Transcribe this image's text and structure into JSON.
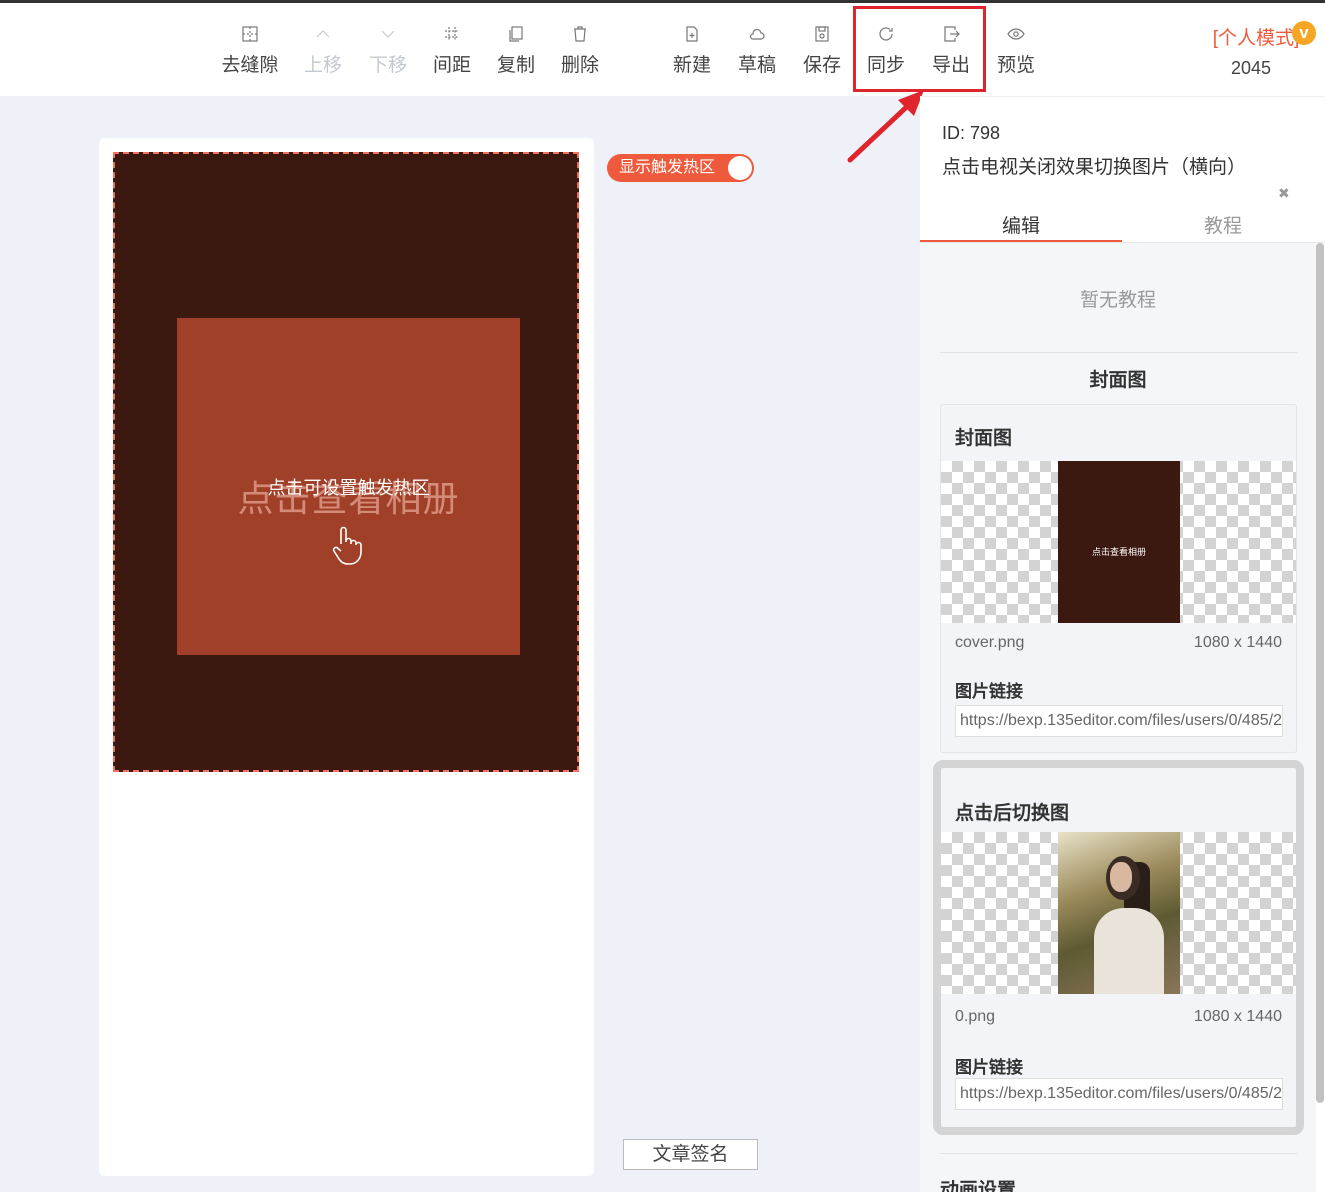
{
  "toolbar": {
    "remove_gap": "去缝隙",
    "move_up": "上移",
    "move_down": "下移",
    "spacing": "间距",
    "copy": "复制",
    "delete": "删除",
    "new": "新建",
    "draft": "草稿",
    "save": "保存",
    "sync": "同步",
    "export": "导出",
    "preview": "预览"
  },
  "mode": {
    "label": "[个人模式]",
    "count": "2045",
    "vip_badge": "v"
  },
  "canvas": {
    "cover_text": "点击查看相册",
    "overlay_hint": "点击可设置触发热区",
    "toggle_label": "显示触发热区",
    "signature": "文章签名"
  },
  "panel": {
    "id": "ID: 798",
    "title": "点击电视关闭效果切换图片（横向）",
    "tabs": [
      "编辑",
      "教程"
    ],
    "no_tutorial": "暂无教程",
    "section_title": "封面图",
    "cover_card": {
      "title": "封面图",
      "thumb_text": "点击查看相册",
      "filename": "cover.png",
      "size": "1080 x 1440",
      "link_label": "图片链接",
      "link": "https://bexp.135editor.com/files/users/0/485/2"
    },
    "switch_card": {
      "title": "点击后切换图",
      "filename": "0.png",
      "size": "1080 x 1440",
      "link_label": "图片链接",
      "link": "https://bexp.135editor.com/files/users/0/485/2"
    },
    "animation_title": "动画设置"
  },
  "colors": {
    "accent": "#f05a3c",
    "cover_bg": "#3b1810",
    "inner_box": "#a04029",
    "highlight": "#e0242b"
  }
}
